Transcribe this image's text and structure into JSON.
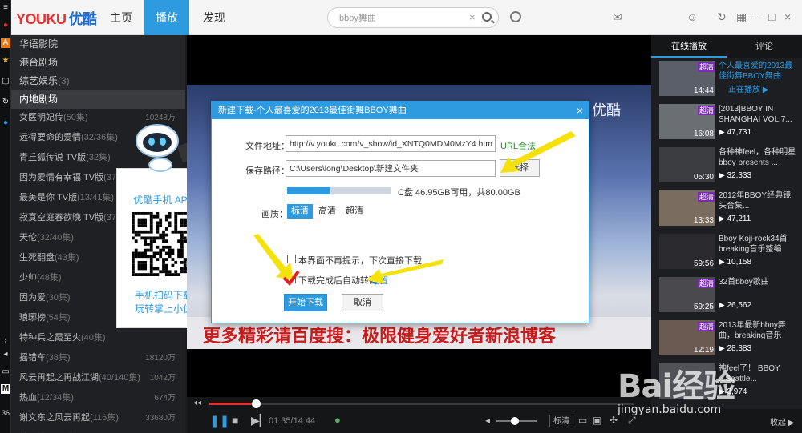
{
  "app": {
    "logo_latin": "YOUKU",
    "logo_cn": "优酷"
  },
  "nav": {
    "tabs": [
      {
        "label": "主页"
      },
      {
        "label": "播放"
      },
      {
        "label": "发现"
      }
    ],
    "active": "播放"
  },
  "search": {
    "value": "bboy舞曲"
  },
  "left_list": {
    "categories": [
      {
        "label": "华语影院"
      },
      {
        "label": "港台剧场"
      },
      {
        "label": "综艺娱乐",
        "count": "(3)"
      },
      {
        "label": "内地剧场"
      }
    ],
    "items": [
      {
        "label": "女医明妃传",
        "count": "(50集)",
        "num": "10248万"
      },
      {
        "label": "远得要命的爱情",
        "count": "(32/36集)",
        "num": ""
      },
      {
        "label": "青丘狐传说 TV版",
        "count": "(32集)",
        "num": ""
      },
      {
        "label": "因为爱情有幸福 TV版",
        "count": "(37集)",
        "num": ""
      },
      {
        "label": "最美是你 TV版",
        "count": "(13/41集)",
        "num": ""
      },
      {
        "label": "寂寞空庭春欲晚 TV版",
        "count": "(37集)",
        "num": ""
      },
      {
        "label": "天伦",
        "count": "(32/40集)",
        "num": ""
      },
      {
        "label": "生死翻盘",
        "count": "(43集)",
        "num": ""
      },
      {
        "label": "少帅",
        "count": "(48集)",
        "num": ""
      },
      {
        "label": "因为爱",
        "count": "(30集)",
        "num": ""
      },
      {
        "label": "琅琊榜",
        "count": "(54集)",
        "num": ""
      },
      {
        "label": "特种兵之霞至火",
        "count": "(40集)",
        "num": ""
      },
      {
        "label": "摇错车",
        "count": "(38集)",
        "num": "18120万"
      },
      {
        "label": "风云再起之再战江湖",
        "count": "(40/140集)",
        "num": "1042万"
      },
      {
        "label": "热血",
        "count": "(12/34集)",
        "num": "674万"
      },
      {
        "label": "谢文东之风云再起",
        "count": "(116集)",
        "num": "33680万"
      },
      {
        "label": "嫂子嫂子",
        "count": "(41集)",
        "num": "2373万"
      }
    ]
  },
  "promo": {
    "title": "优酷手机 APP",
    "line1": "手机扫码下载",
    "line2": "玩转掌上小优"
  },
  "video": {
    "watermark": "优酷",
    "banner": "更多精彩请百度搜：极限健身爱好者新浪博客"
  },
  "dialog": {
    "title": "新建下载-个人最喜爱的2013最佳街舞BBOY舞曲",
    "url_label": "文件地址：",
    "url_value": "http://v.youku.com/v_show/id_XNTQ0MDM0MzY4.html",
    "url_ok": "URL合法",
    "path_label": "保存路径：",
    "path_value": "C:\\Users\\long\\Desktop\\新建文件夹",
    "choose_label": "选择",
    "disk_text": "C盘 46.95GB可用，共80.00GB",
    "disk_used_fraction": 0.41,
    "quality_label": "画质：",
    "qualities": [
      {
        "label": "标清"
      },
      {
        "label": "高清"
      },
      {
        "label": "超清"
      }
    ],
    "quality_selected": "标清",
    "no_prompt_label": "本界面不再提示，下次直接下载",
    "transcode_label": "下载完成后自动转码",
    "settings_label": "设置",
    "start_label": "开始下载",
    "cancel_label": "取消",
    "close_glyph": "×"
  },
  "player": {
    "time": "01:35/14:44",
    "quality": "标清",
    "progress_fraction": 0.11,
    "volume_fraction": 0.45
  },
  "right": {
    "tabs": [
      {
        "label": "在线播放"
      },
      {
        "label": "评论"
      }
    ],
    "items": [
      {
        "badge": "超清",
        "title": "个人最喜爱的2013最佳街舞BBOY舞曲",
        "duration": "14:44",
        "plays": "",
        "playing": "正在播放 ▶"
      },
      {
        "badge": "超清",
        "title": "[2013]BBOY IN SHANGHAI VOL.7...",
        "duration": "16:08",
        "plays": "▶ 47,731",
        "playing": ""
      },
      {
        "badge": "",
        "title": "各种神feel，各种明星bboy presents ...",
        "duration": "05:30",
        "plays": "▶ 32,333",
        "playing": ""
      },
      {
        "badge": "超清",
        "title": "2012年BBOY经典镜头合集...",
        "duration": "13:33",
        "plays": "▶ 47,211",
        "playing": ""
      },
      {
        "badge": "",
        "title": "Bboy Koji-rock34首 breaking音乐整编",
        "duration": "59:56",
        "plays": "▶ 10,158",
        "playing": ""
      },
      {
        "badge": "超清",
        "title": "32首bboy歌曲",
        "duration": "59:25",
        "plays": "▶ 26,562",
        "playing": ""
      },
      {
        "badge": "超清",
        "title": "2013年最新bboy舞曲，breaking音乐",
        "duration": "12:19",
        "plays": "▶ 28,383",
        "playing": ""
      },
      {
        "badge": "",
        "title": "神feel了！ BBOY ...Seattle...",
        "duration": "",
        "plays": "▶ 3,974",
        "playing": ""
      }
    ],
    "footer": "收起 ▶"
  },
  "baidu": {
    "brand": "Bai经验",
    "url": "jingyan.baidu.com"
  },
  "colors": {
    "accent": "#2e9ae0",
    "brand_red": "#e3312f",
    "badge": "#7b2bb3",
    "arrow": "#f5e20c"
  }
}
